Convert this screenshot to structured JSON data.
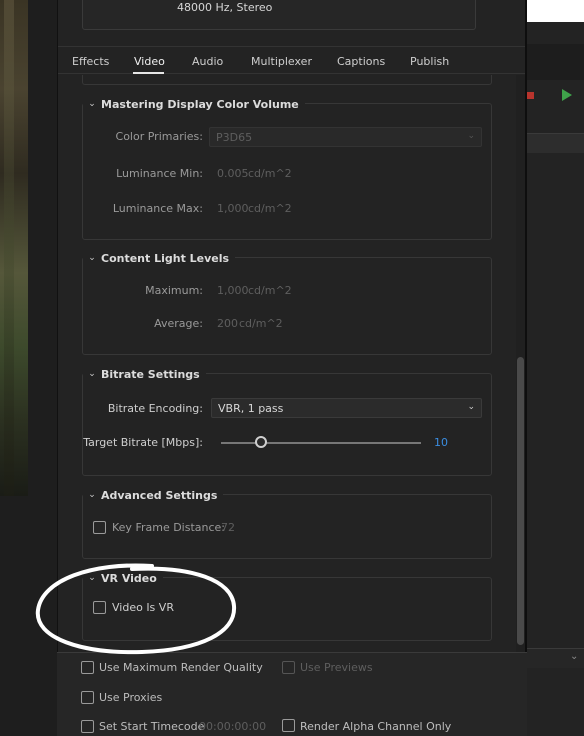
{
  "summary": {
    "audio_text": "48000 Hz, Stereo"
  },
  "tabs": [
    {
      "label": "Effects"
    },
    {
      "label": "Video"
    },
    {
      "label": "Audio"
    },
    {
      "label": "Multiplexer"
    },
    {
      "label": "Captions"
    },
    {
      "label": "Publish"
    }
  ],
  "mastering": {
    "title": "Mastering Display Color Volume",
    "color_primaries_label": "Color Primaries:",
    "color_primaries_value": "P3D65",
    "lum_min_label": "Luminance Min:",
    "lum_min_value": "0.005",
    "lum_min_unit": "cd/m^2",
    "lum_max_label": "Luminance Max:",
    "lum_max_value": "1,000",
    "lum_max_unit": "cd/m^2"
  },
  "content_light": {
    "title": "Content Light Levels",
    "maximum_label": "Maximum:",
    "maximum_value": "1,000",
    "maximum_unit": "cd/m^2",
    "average_label": "Average:",
    "average_value": "200",
    "average_unit": "cd/m^2"
  },
  "bitrate": {
    "title": "Bitrate Settings",
    "encoding_label": "Bitrate Encoding:",
    "encoding_value": "VBR, 1 pass",
    "target_label": "Target Bitrate [Mbps]:",
    "target_value": "10",
    "target_fraction": 0.2
  },
  "advanced": {
    "title": "Advanced Settings",
    "keyframe_label": "Key Frame Distance:",
    "keyframe_value": "72"
  },
  "vr": {
    "title": "VR Video",
    "video_is_vr_label": "Video Is VR"
  },
  "bottom": {
    "max_render_label": "Use Maximum Render Quality",
    "use_previews_label": "Use Previews",
    "use_proxies_label": "Use Proxies",
    "set_start_timecode_label": "Set Start Timecode",
    "start_timecode_value": "00:00:00:00",
    "render_alpha_label": "Render Alpha Channel Only"
  },
  "colors": {
    "accent_blue": "#3a8de0",
    "annotation_white": "#ffffff"
  }
}
